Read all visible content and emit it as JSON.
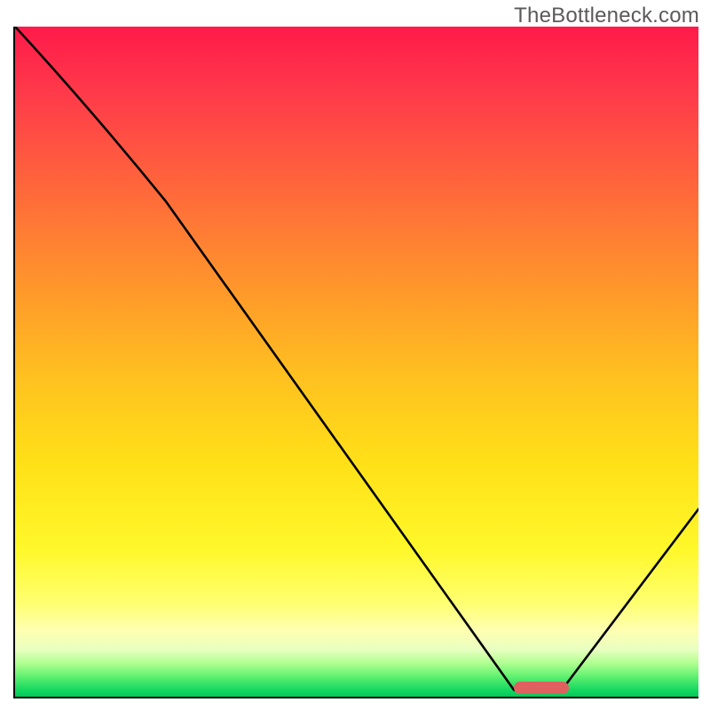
{
  "watermark": "TheBottleneck.com",
  "chart_data": {
    "type": "line",
    "title": "",
    "xlabel": "",
    "ylabel": "",
    "xlim": [
      0,
      100
    ],
    "ylim": [
      0,
      100
    ],
    "series": [
      {
        "name": "curve",
        "points": [
          {
            "x": 0,
            "y": 100
          },
          {
            "x": 22,
            "y": 74
          },
          {
            "x": 73,
            "y": 1
          },
          {
            "x": 80,
            "y": 1
          },
          {
            "x": 100,
            "y": 28
          }
        ]
      }
    ],
    "marker": {
      "x_start": 73,
      "x_end": 81,
      "y": 1.3
    },
    "gradient_stops": [
      {
        "pct": 0,
        "color": "#ff1a4a"
      },
      {
        "pct": 50,
        "color": "#ffc020"
      },
      {
        "pct": 85,
        "color": "#ffff70"
      },
      {
        "pct": 100,
        "color": "#00c858"
      }
    ]
  }
}
